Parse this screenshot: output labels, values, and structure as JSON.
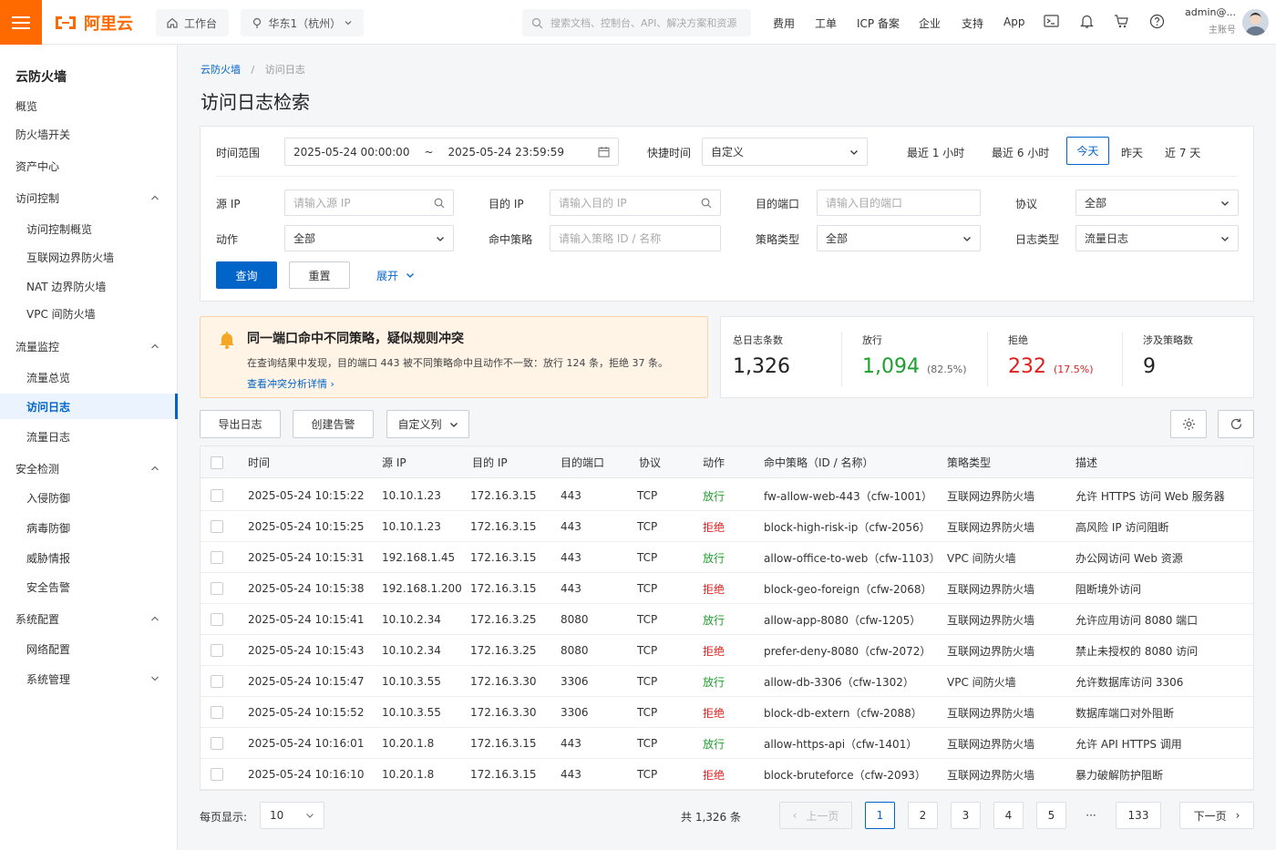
{
  "topbar": {
    "logo_text": "阿里云",
    "workbench": "工作台",
    "region": "华东1（杭州）",
    "search_placeholder": "搜索文档、控制台、API、解决方案和资源",
    "links": [
      "费用",
      "工单",
      "ICP 备案",
      "企业",
      "支持",
      "App"
    ],
    "user_name": "admin@...",
    "user_role": "主账号",
    "brand_color": "#ff6a00"
  },
  "sidebar": {
    "title": "云防火墙",
    "items": [
      {
        "label": "概览",
        "level": 1
      },
      {
        "label": "防火墙开关",
        "level": 1
      },
      {
        "label": "资产中心",
        "level": 1
      },
      {
        "label": "访问控制",
        "level": 1,
        "expand": "up"
      },
      {
        "label": "访问控制概览",
        "level": 2
      },
      {
        "label": "互联网边界防火墙",
        "level": 2
      },
      {
        "label": "NAT 边界防火墙",
        "level": 2
      },
      {
        "label": "VPC 间防火墙",
        "level": 2
      },
      {
        "label": "流量监控",
        "level": 1,
        "expand": "up"
      },
      {
        "label": "流量总览",
        "level": 2
      },
      {
        "label": "访问日志",
        "level": 2,
        "active": true
      },
      {
        "label": "流量日志",
        "level": 2
      },
      {
        "label": "安全检测",
        "level": 1,
        "expand": "up"
      },
      {
        "label": "入侵防御",
        "level": 2
      },
      {
        "label": "病毒防御",
        "level": 2
      },
      {
        "label": "威胁情报",
        "level": 2
      },
      {
        "label": "安全告警",
        "level": 2
      },
      {
        "label": "系统配置",
        "level": 1,
        "expand": "up"
      },
      {
        "label": "网络配置",
        "level": 2
      },
      {
        "label": "系统管理",
        "level": 2,
        "expand": "down"
      }
    ]
  },
  "breadcrumb": {
    "root": "云防火墙",
    "sep": "/",
    "current": "访问日志"
  },
  "page_title": "访问日志检索",
  "filter": {
    "time_label": "时间范围",
    "time_start": "2025-05-24 00:00:00",
    "time_sep": "~",
    "time_end": "2025-05-24 23:59:59",
    "quick_label": "快捷时间",
    "quick_value": "自定义",
    "quick_options": [
      "最近 1 小时",
      "最近 6 小时",
      "今天",
      "昨天",
      "近 7 天"
    ],
    "quick_selected": "今天",
    "src_ip_label": "源 IP",
    "src_ip_placeholder": "请输入源 IP",
    "dst_ip_label": "目的 IP",
    "dst_ip_placeholder": "请输入目的 IP",
    "dst_port_label": "目的端口",
    "dst_port_placeholder": "请输入目的端口",
    "proto_label": "协议",
    "proto_value": "全部",
    "action_label": "动作",
    "action_value": "全部",
    "policy_label": "命中策略",
    "policy_placeholder": "请输入策略 ID / 名称",
    "policy_type_label": "策略类型",
    "policy_type_value": "全部",
    "log_type_label": "日志类型",
    "log_type_value": "流量日志",
    "query": "查询",
    "reset": "重置",
    "expand": "展开"
  },
  "alert": {
    "title": "同一端口命中不同策略，疑似规则冲突",
    "body": "在查询结果中发现，目的端口 443 被不同策略命中且动作不一致：放行 124 条，拒绝 37 条。",
    "link": "查看冲突分析详情"
  },
  "stats": {
    "total_label": "总日志条数",
    "total_value": "1,326",
    "allow_label": "放行",
    "allow_value": "1,094",
    "allow_pct": "(82.5%)",
    "deny_label": "拒绝",
    "deny_value": "232",
    "deny_pct": "(17.5%)",
    "policy_label": "涉及策略数",
    "policy_value": "9"
  },
  "toolbar": {
    "export": "导出日志",
    "create_alert": "创建告警",
    "custom_cols": "自定义列"
  },
  "table": {
    "headers": [
      "时间",
      "源 IP",
      "目的 IP",
      "目的端口",
      "协议",
      "动作",
      "命中策略（ID / 名称）",
      "策略类型",
      "描述"
    ],
    "rows": [
      [
        "2025-05-24 10:15:22",
        "10.10.1.23",
        "172.16.3.15",
        "443",
        "TCP",
        "放行",
        "fw-allow-web-443（cfw-1001）",
        "互联网边界防火墙",
        "允许 HTTPS 访问 Web 服务器"
      ],
      [
        "2025-05-24 10:15:25",
        "10.10.1.23",
        "172.16.3.15",
        "443",
        "TCP",
        "拒绝",
        "block-high-risk-ip（cfw-2056）",
        "互联网边界防火墙",
        "高风险 IP 访问阻断"
      ],
      [
        "2025-05-24 10:15:31",
        "192.168.1.45",
        "172.16.3.15",
        "443",
        "TCP",
        "放行",
        "allow-office-to-web（cfw-1103）",
        "VPC 间防火墙",
        "办公网访问 Web 资源"
      ],
      [
        "2025-05-24 10:15:38",
        "192.168.1.200",
        "172.16.3.15",
        "443",
        "TCP",
        "拒绝",
        "block-geo-foreign（cfw-2068）",
        "互联网边界防火墙",
        "阻断境外访问"
      ],
      [
        "2025-05-24 10:15:41",
        "10.10.2.34",
        "172.16.3.25",
        "8080",
        "TCP",
        "放行",
        "allow-app-8080（cfw-1205）",
        "互联网边界防火墙",
        "允许应用访问 8080 端口"
      ],
      [
        "2025-05-24 10:15:43",
        "10.10.2.34",
        "172.16.3.25",
        "8080",
        "TCP",
        "拒绝",
        "prefer-deny-8080（cfw-2072）",
        "互联网边界防火墙",
        "禁止未授权的 8080 访问"
      ],
      [
        "2025-05-24 10:15:47",
        "10.10.3.55",
        "172.16.3.30",
        "3306",
        "TCP",
        "放行",
        "allow-db-3306（cfw-1302）",
        "VPC 间防火墙",
        "允许数据库访问 3306"
      ],
      [
        "2025-05-24 10:15:52",
        "10.10.3.55",
        "172.16.3.30",
        "3306",
        "TCP",
        "拒绝",
        "block-db-extern（cfw-2088）",
        "互联网边界防火墙",
        "数据库端口对外阻断"
      ],
      [
        "2025-05-24 10:16:01",
        "10.20.1.8",
        "172.16.3.15",
        "443",
        "TCP",
        "放行",
        "allow-https-api（cfw-1401）",
        "互联网边界防火墙",
        "允许 API HTTPS 调用"
      ],
      [
        "2025-05-24 10:16:10",
        "10.20.1.8",
        "172.16.3.15",
        "443",
        "TCP",
        "拒绝",
        "block-bruteforce（cfw-2093）",
        "互联网边界防火墙",
        "暴力破解防护阻断"
      ]
    ]
  },
  "pager": {
    "per_page_label": "每页显示:",
    "per_page": "10",
    "total": "共 1,326 条",
    "prev": "上一页",
    "next": "下一页",
    "pages": [
      "1",
      "2",
      "3",
      "4",
      "5",
      "···",
      "133"
    ],
    "current": "1"
  }
}
